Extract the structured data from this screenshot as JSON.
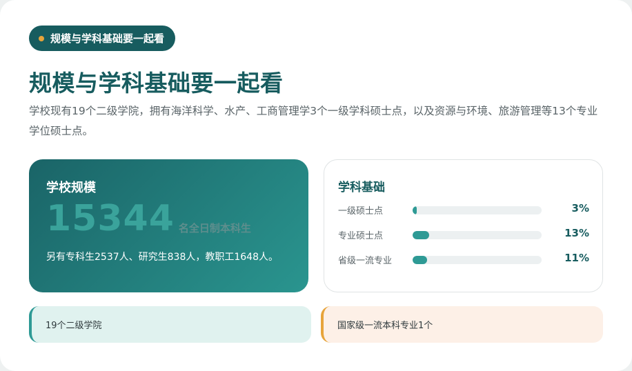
{
  "header": {
    "pill_label": "规模与学科基础要一起看",
    "title": "规模与学科基础要一起看",
    "description": "学校现有19个二级学院，拥有海洋科学、水产、工商管理学3个一级学科硕士点，以及资源与环境、旅游管理等13个专业学位硕士点。"
  },
  "scale": {
    "title": "学校规模",
    "number": "15344",
    "unit": "名全日制本科生",
    "note": "另有专科生2537人、研究生838人，教职工1648人。"
  },
  "base": {
    "title": "学科基础",
    "bars": [
      {
        "label": "一级硕士点",
        "value_text": "3%",
        "percent": 3
      },
      {
        "label": "专业硕士点",
        "value_text": "13%",
        "percent": 13
      },
      {
        "label": "省级一流专业",
        "value_text": "11%",
        "percent": 11
      }
    ]
  },
  "tags": {
    "left": "19个二级学院",
    "right": "国家级一流本科专业1个"
  },
  "colors": {
    "primary": "#175c5f",
    "accent": "#e7a43b",
    "bar_fill": "#2e9a95"
  }
}
